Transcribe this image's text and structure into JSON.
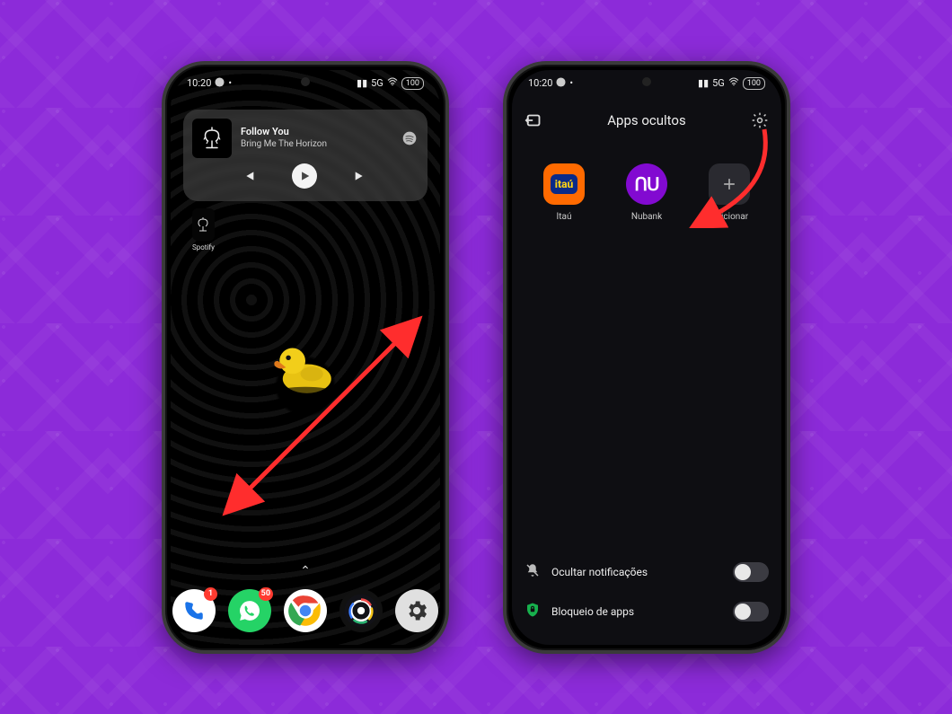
{
  "status": {
    "time": "10:20",
    "net": "5G",
    "batt": "100"
  },
  "phone1": {
    "widget": {
      "song": "Follow You",
      "artist": "Bring Me The Horizon",
      "thumb_caption": "Spotify"
    },
    "dock": {
      "phone_badge": "1",
      "whatsapp_badge": "50"
    }
  },
  "phone2": {
    "title": "Apps ocultos",
    "items": [
      {
        "label": "Itaú"
      },
      {
        "label": "Nubank"
      },
      {
        "label": "Adicionar"
      }
    ],
    "opt_notifications": "Ocultar notificações",
    "opt_applock": "Bloqueio de apps"
  },
  "colors": {
    "accent_red": "#ff2d2d",
    "itau_orange": "#ff6a00",
    "itau_blue": "#0a2a88",
    "nubank": "#820ad1",
    "whatsapp": "#25D366",
    "chrome_y": "#fbbc05",
    "chrome_r": "#ea4335",
    "chrome_g": "#34a853",
    "chrome_b": "#4285f4",
    "settings": "#e0e0e0"
  }
}
